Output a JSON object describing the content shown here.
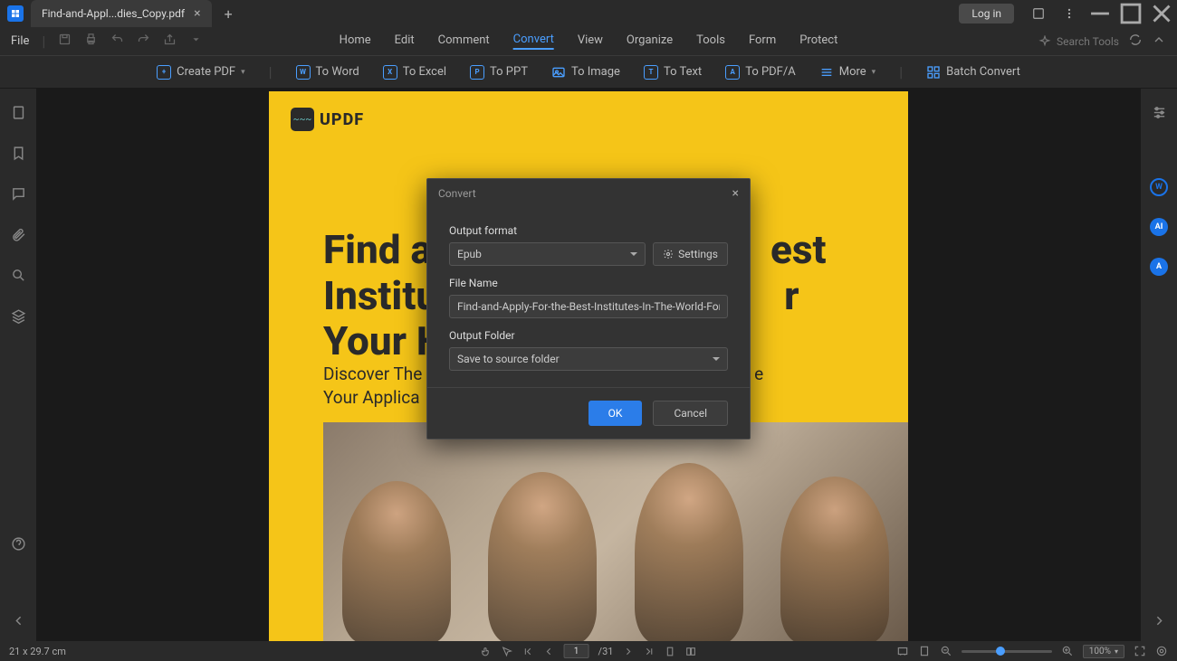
{
  "tab": {
    "title": "Find-and-Appl...dies_Copy.pdf"
  },
  "titlebar": {
    "login": "Log in"
  },
  "file_menu": "File",
  "menu": [
    "Home",
    "Edit",
    "Comment",
    "Convert",
    "View",
    "Organize",
    "Tools",
    "Form",
    "Protect"
  ],
  "menu_active": "Convert",
  "search_placeholder": "Search Tools",
  "toolbar": {
    "create": "Create PDF",
    "to_word": "To Word",
    "to_excel": "To Excel",
    "to_ppt": "To PPT",
    "to_image": "To Image",
    "to_text": "To Text",
    "to_pdfa": "To PDF/A",
    "more": "More",
    "batch": "Batch Convert"
  },
  "doc": {
    "logo": "UPDF",
    "h1_l1": "Find a",
    "h1_l2": "Institu",
    "h1_l3": "Your H",
    "h1_r1": "est",
    "h1_r2": "r",
    "sub_l1": "Discover The",
    "sub_l2": "Your Applica",
    "sub_r1": "e"
  },
  "dialog": {
    "title": "Convert",
    "output_format_label": "Output format",
    "output_format_value": "Epub",
    "settings": "Settings",
    "file_name_label": "File Name",
    "file_name_value": "Find-and-Apply-For-the-Best-Institutes-In-The-World-For-Your-H",
    "output_folder_label": "Output Folder",
    "output_folder_value": "Save to source folder",
    "ok": "OK",
    "cancel": "Cancel"
  },
  "status": {
    "dimensions": "21 x 29.7 cm",
    "page_current": "1",
    "page_total": "/31",
    "zoom": "100%"
  }
}
